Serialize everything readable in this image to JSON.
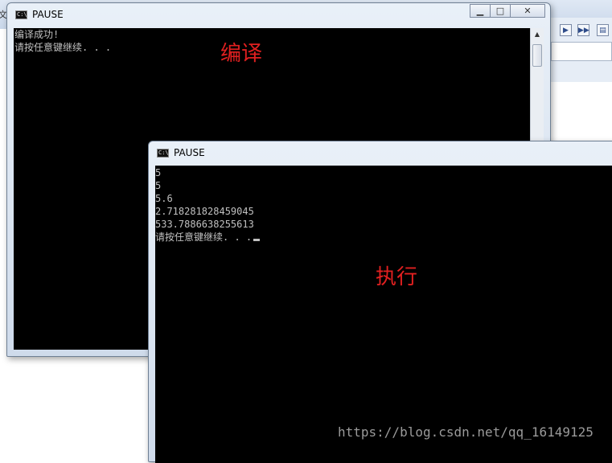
{
  "background_app": {
    "left_char": "文"
  },
  "window_compile": {
    "title": "PAUSE",
    "lines": [
      "编译成功!",
      "请按任意键继续. . ."
    ],
    "annotation": "编译"
  },
  "window_run": {
    "title": "PAUSE",
    "lines": [
      "5",
      "5",
      "5.6",
      "2.718281828459045",
      "533.7886638255613",
      "请按任意键继续. . ."
    ],
    "annotation": "执行"
  },
  "watermark": "https://blog.csdn.net/qq_16149125",
  "colors": {
    "console_bg": "#000000",
    "console_text": "#c0c0c0",
    "annotation": "#e02020",
    "titlebar": "#dbe6f3"
  },
  "icons": {
    "cmd": "cmd-icon",
    "minimize": "minimize-icon",
    "maximize": "maximize-icon",
    "close": "close-icon"
  }
}
